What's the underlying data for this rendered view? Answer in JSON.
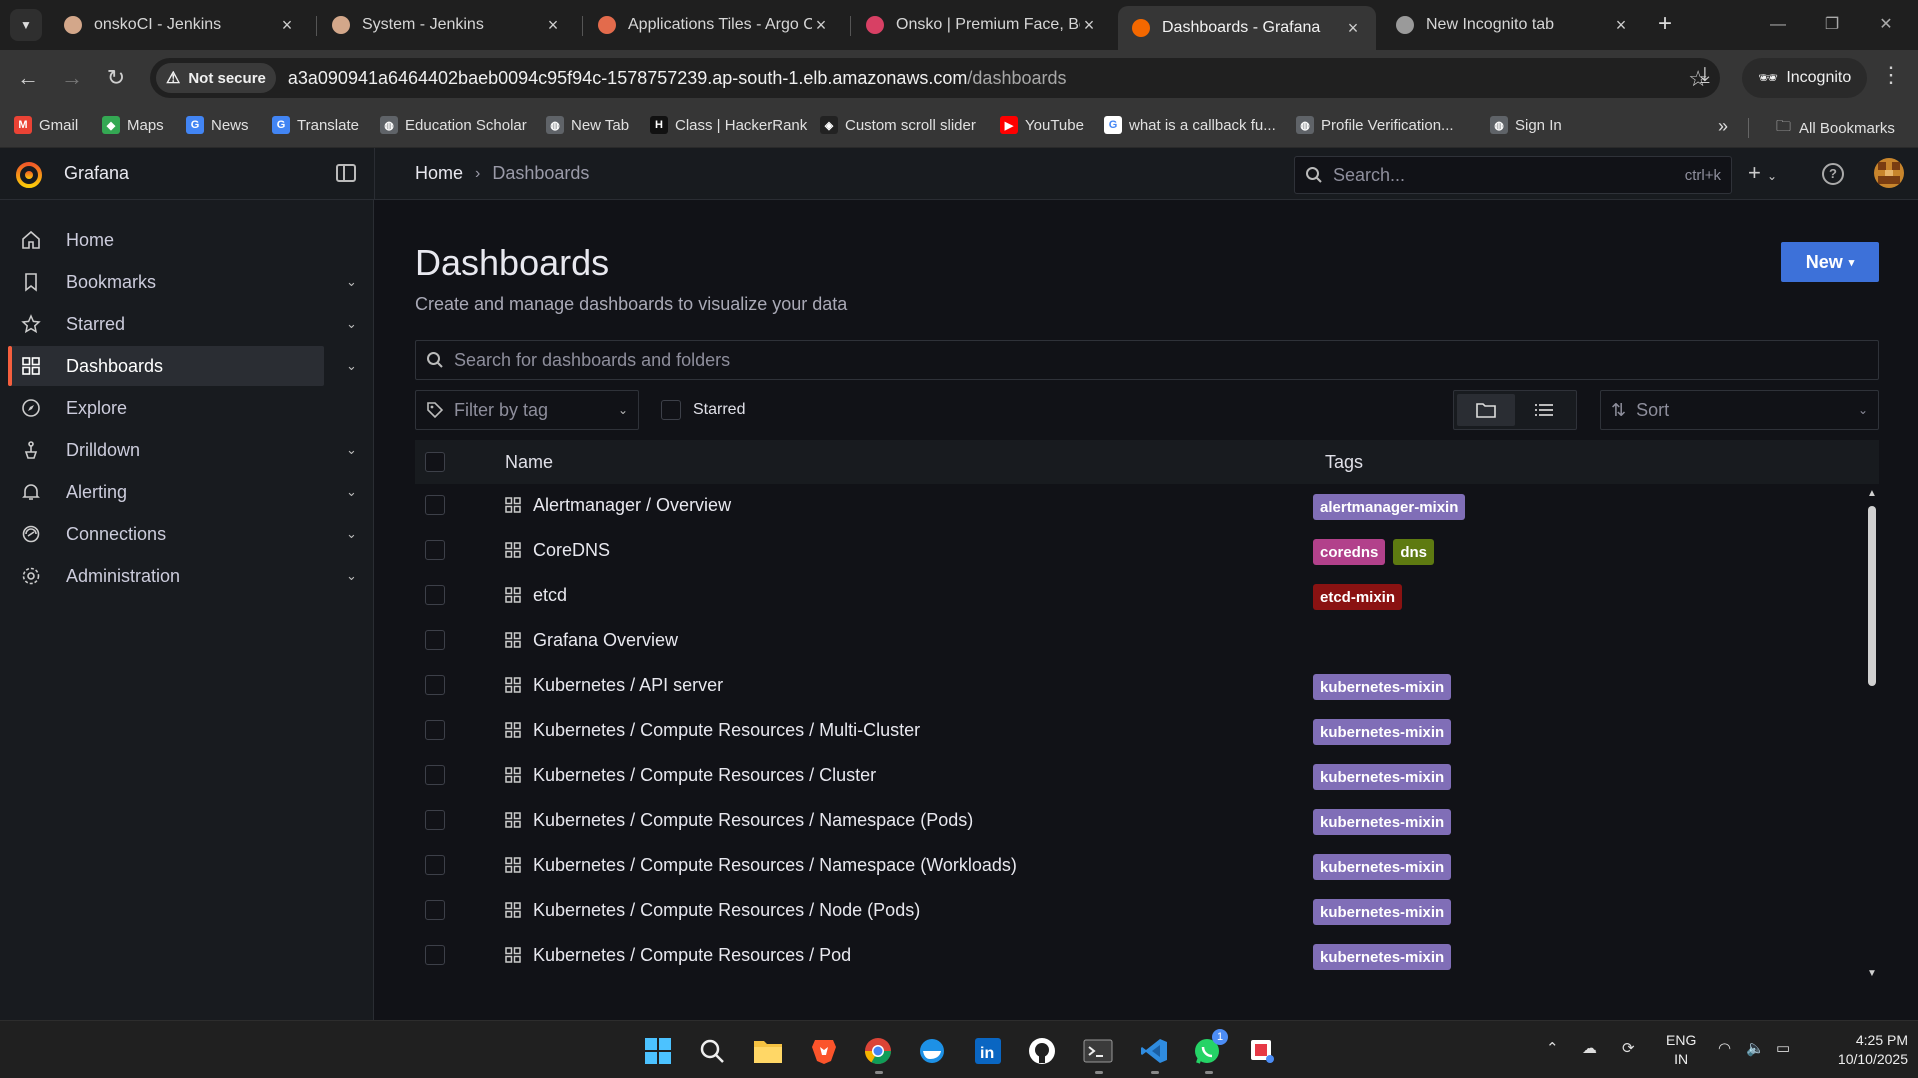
{
  "browser": {
    "tabs": [
      {
        "title": "onskoCI - Jenkins",
        "favicon_color": "#d3a78a"
      },
      {
        "title": "System - Jenkins",
        "favicon_color": "#d3a78a"
      },
      {
        "title": "Applications Tiles - Argo C",
        "favicon_color": "#e36b4c"
      },
      {
        "title": "Onsko | Premium Face, Boc",
        "favicon_color": "#d84064"
      },
      {
        "title": "Dashboards - Grafana",
        "favicon_color": "#f46800"
      },
      {
        "title": "New Incognito tab",
        "favicon_color": "#9a9a9a"
      }
    ],
    "active_tab": 4,
    "not_secure_label": "Not secure",
    "url_host": "a3a090941a6464402baeb0094c95f94c-1578757239.ap-south-1.elb.amazonaws.com",
    "url_path": "/dashboards",
    "incognito_label": "Incognito",
    "bookmarks": [
      {
        "label": "Gmail",
        "icon_color": "#ea4335",
        "glyph": "M"
      },
      {
        "label": "Maps",
        "icon_color": "#34a853",
        "glyph": "◆"
      },
      {
        "label": "News",
        "icon_color": "#4285f4",
        "glyph": "G"
      },
      {
        "label": "Translate",
        "icon_color": "#4285f4",
        "glyph": "G"
      },
      {
        "label": "Education Scholar",
        "icon_color": "#5f6368",
        "glyph": "◍"
      },
      {
        "label": "New Tab",
        "icon_color": "#5f6368",
        "glyph": "◍"
      },
      {
        "label": "Class | HackerRank",
        "icon_color": "#111111",
        "glyph": "H"
      },
      {
        "label": "Custom scroll slider",
        "icon_color": "#222222",
        "glyph": "◈"
      },
      {
        "label": "YouTube",
        "icon_color": "#ff0000",
        "glyph": "▶"
      },
      {
        "label": "what is a callback fu...",
        "icon_color": "#ffffff",
        "glyph": "G"
      },
      {
        "label": "Profile Verification...",
        "icon_color": "#5f6368",
        "glyph": "◍"
      },
      {
        "label": "Sign In",
        "icon_color": "#5f6368",
        "glyph": "◍"
      }
    ],
    "all_bookmarks_label": "All Bookmarks"
  },
  "grafana": {
    "brand": "Grafana",
    "breadcrumb": {
      "home": "Home",
      "current": "Dashboards"
    },
    "search_placeholder": "Search...",
    "search_shortcut": "ctrl+k",
    "nav": [
      {
        "label": "Home",
        "icon": "home-icon",
        "expandable": false
      },
      {
        "label": "Bookmarks",
        "icon": "bookmark-icon",
        "expandable": true
      },
      {
        "label": "Starred",
        "icon": "star-icon",
        "expandable": true
      },
      {
        "label": "Dashboards",
        "icon": "apps-icon",
        "expandable": true,
        "active": true
      },
      {
        "label": "Explore",
        "icon": "compass-icon",
        "expandable": false
      },
      {
        "label": "Drilldown",
        "icon": "drilldown-icon",
        "expandable": true
      },
      {
        "label": "Alerting",
        "icon": "bell-icon",
        "expandable": true
      },
      {
        "label": "Connections",
        "icon": "connections-icon",
        "expandable": true
      },
      {
        "label": "Administration",
        "icon": "cog-icon",
        "expandable": true
      }
    ],
    "page": {
      "title": "Dashboards",
      "subtitle": "Create and manage dashboards to visualize your data",
      "new_button": "New",
      "search_placeholder": "Search for dashboards and folders",
      "filter_by_tag_placeholder": "Filter by tag",
      "starred_label": "Starred",
      "sort_label": "Sort",
      "columns": {
        "name": "Name",
        "tags": "Tags"
      },
      "rows": [
        {
          "name": "Alertmanager / Overview",
          "tags": [
            {
              "label": "alertmanager-mixin",
              "color": "#806eb7"
            }
          ]
        },
        {
          "name": "CoreDNS",
          "tags": [
            {
              "label": "coredns",
              "color": "#b2418b"
            },
            {
              "label": "dns",
              "color": "#5e7a11"
            }
          ]
        },
        {
          "name": "etcd",
          "tags": [
            {
              "label": "etcd-mixin",
              "color": "#8a1212"
            }
          ]
        },
        {
          "name": "Grafana Overview",
          "tags": []
        },
        {
          "name": "Kubernetes / API server",
          "tags": [
            {
              "label": "kubernetes-mixin",
              "color": "#806eb7"
            }
          ]
        },
        {
          "name": "Kubernetes / Compute Resources / Multi-Cluster",
          "tags": [
            {
              "label": "kubernetes-mixin",
              "color": "#806eb7"
            }
          ]
        },
        {
          "name": "Kubernetes / Compute Resources / Cluster",
          "tags": [
            {
              "label": "kubernetes-mixin",
              "color": "#806eb7"
            }
          ]
        },
        {
          "name": "Kubernetes / Compute Resources / Namespace (Pods)",
          "tags": [
            {
              "label": "kubernetes-mixin",
              "color": "#806eb7"
            }
          ]
        },
        {
          "name": "Kubernetes / Compute Resources / Namespace (Workloads)",
          "tags": [
            {
              "label": "kubernetes-mixin",
              "color": "#806eb7"
            }
          ]
        },
        {
          "name": "Kubernetes / Compute Resources / Node (Pods)",
          "tags": [
            {
              "label": "kubernetes-mixin",
              "color": "#806eb7"
            }
          ]
        },
        {
          "name": "Kubernetes / Compute Resources / Pod",
          "tags": [
            {
              "label": "kubernetes-mixin",
              "color": "#806eb7"
            }
          ]
        }
      ]
    }
  },
  "taskbar": {
    "language": "ENG",
    "region": "IN",
    "time": "4:25 PM",
    "date": "10/10/2025",
    "whatsapp_badge": "1"
  }
}
